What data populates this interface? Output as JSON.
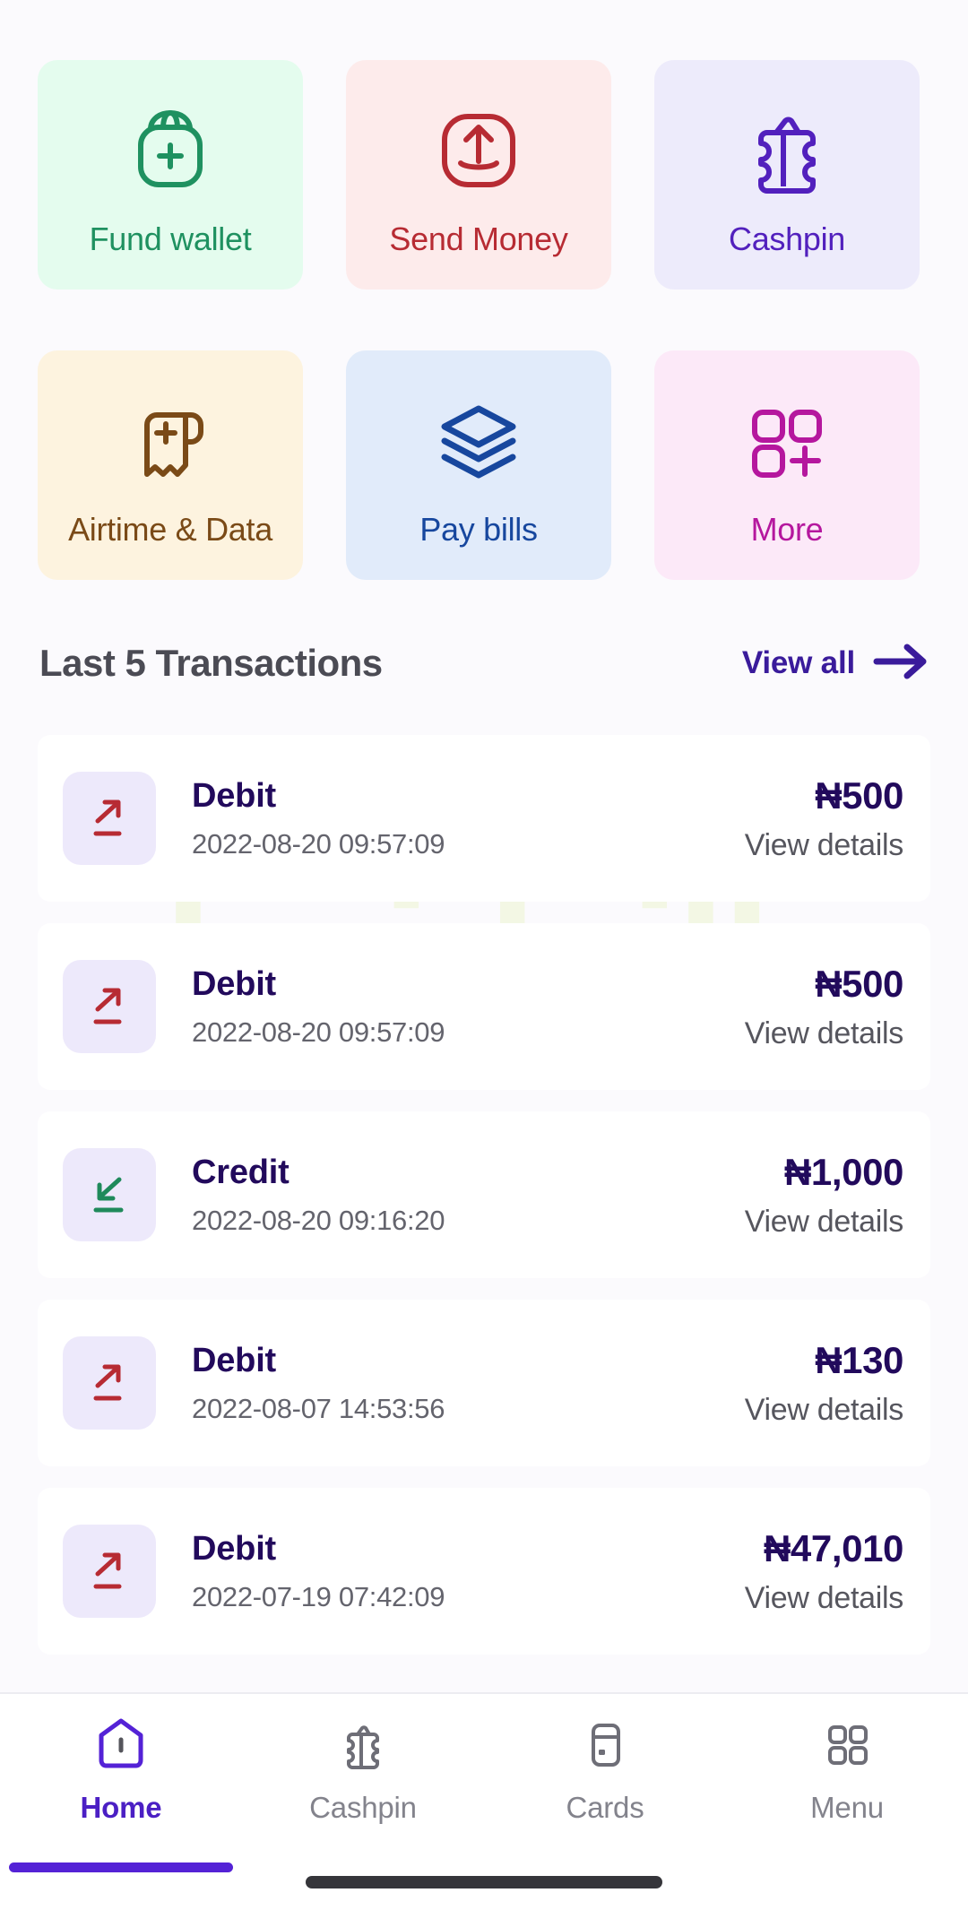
{
  "watermark": {
    "text": "droidvilla"
  },
  "quick_actions": [
    {
      "label": "Fund wallet",
      "icon": "wallet-plus-icon",
      "bg": "#E4FCEE",
      "fg": "#1F9160"
    },
    {
      "label": "Send Money",
      "icon": "send-money-icon",
      "bg": "#FDEBEB",
      "fg": "#B72B33"
    },
    {
      "label": "Cashpin",
      "icon": "cashpin-bag-icon",
      "bg": "#EDEBFB",
      "fg": "#5220BD"
    },
    {
      "label": "Airtime & Data",
      "icon": "receipt-plus-icon",
      "bg": "#FDF3DF",
      "fg": "#7A4A17"
    },
    {
      "label": "Pay bills",
      "icon": "layers-icon",
      "bg": "#E1EBFA",
      "fg": "#17479E"
    },
    {
      "label": "More",
      "icon": "grid-plus-icon",
      "bg": "#FCE9F8",
      "fg": "#B5179E"
    }
  ],
  "transactions_section": {
    "title": "Last 5 Transactions",
    "view_all_label": "View all",
    "view_all_icon": "arrow-right-icon",
    "details_label": "View details"
  },
  "transactions": [
    {
      "type": "Debit",
      "date": "2022-08-20 09:57:09",
      "amount": "₦500",
      "details": "View details",
      "direction": "out",
      "icon": "arrow-up-right-icon",
      "icon_color": "#B72B33"
    },
    {
      "type": "Debit",
      "date": "2022-08-20 09:57:09",
      "amount": "₦500",
      "details": "View details",
      "direction": "out",
      "icon": "arrow-up-right-icon",
      "icon_color": "#B72B33"
    },
    {
      "type": "Credit",
      "date": "2022-08-20 09:16:20",
      "amount": "₦1,000",
      "details": "View details",
      "direction": "in",
      "icon": "arrow-down-left-icon",
      "icon_color": "#1F8A5B"
    },
    {
      "type": "Debit",
      "date": "2022-08-07 14:53:56",
      "amount": "₦130",
      "details": "View details",
      "direction": "out",
      "icon": "arrow-up-right-icon",
      "icon_color": "#B72B33"
    },
    {
      "type": "Debit",
      "date": "2022-07-19 07:42:09",
      "amount": "₦47,010",
      "details": "View details",
      "direction": "out",
      "icon": "arrow-up-right-icon",
      "icon_color": "#B72B33"
    }
  ],
  "bottom_nav": {
    "active_index": 0,
    "items": [
      {
        "label": "Home",
        "icon": "home-pentagon-icon"
      },
      {
        "label": "Cashpin",
        "icon": "cashpin-bag-icon"
      },
      {
        "label": "Cards",
        "icon": "card-icon"
      },
      {
        "label": "Menu",
        "icon": "grid-menu-icon"
      }
    ]
  },
  "colors": {
    "screen_bg": "#FBFAFD",
    "card_bg": "#FFFFFF",
    "accent_purple": "#5422D6",
    "deep_purple_text": "#220A5C",
    "muted_text": "#64646D",
    "watermark": "#F3F7E4"
  }
}
